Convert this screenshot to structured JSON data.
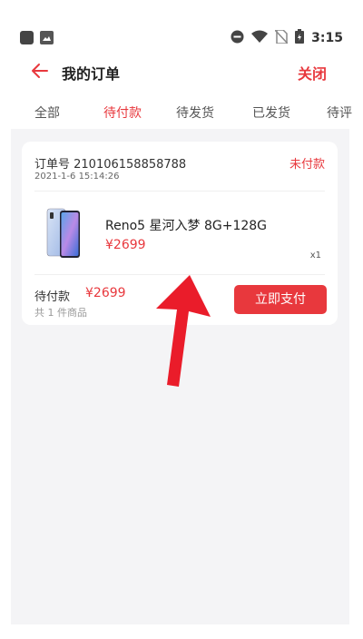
{
  "status_bar": {
    "time": "3:15",
    "icons": [
      "app-icon",
      "gallery-icon",
      "dnd-icon",
      "wifi-icon",
      "no-sim-icon",
      "battery-icon"
    ]
  },
  "header": {
    "title": "我的订单",
    "close_label": "关闭"
  },
  "tabs": [
    {
      "label": "全部"
    },
    {
      "label": "待付款",
      "active": true
    },
    {
      "label": "待发货"
    },
    {
      "label": "已发货"
    },
    {
      "label": "待评"
    }
  ],
  "order": {
    "order_no": "订单号 210106158858788",
    "date": "2021-1-6 15:14:26",
    "status": "未付款",
    "product": {
      "name": "Reno5 星河入梦 8G+128G",
      "price": "¥2699",
      "qty": "x1"
    },
    "due_label": "待付款",
    "due_amount": "¥2699",
    "item_count": "共 1 件商品",
    "pay_label": "立即支付"
  },
  "colors": {
    "accent": "#e8383d",
    "background": "#f4f4f6"
  }
}
